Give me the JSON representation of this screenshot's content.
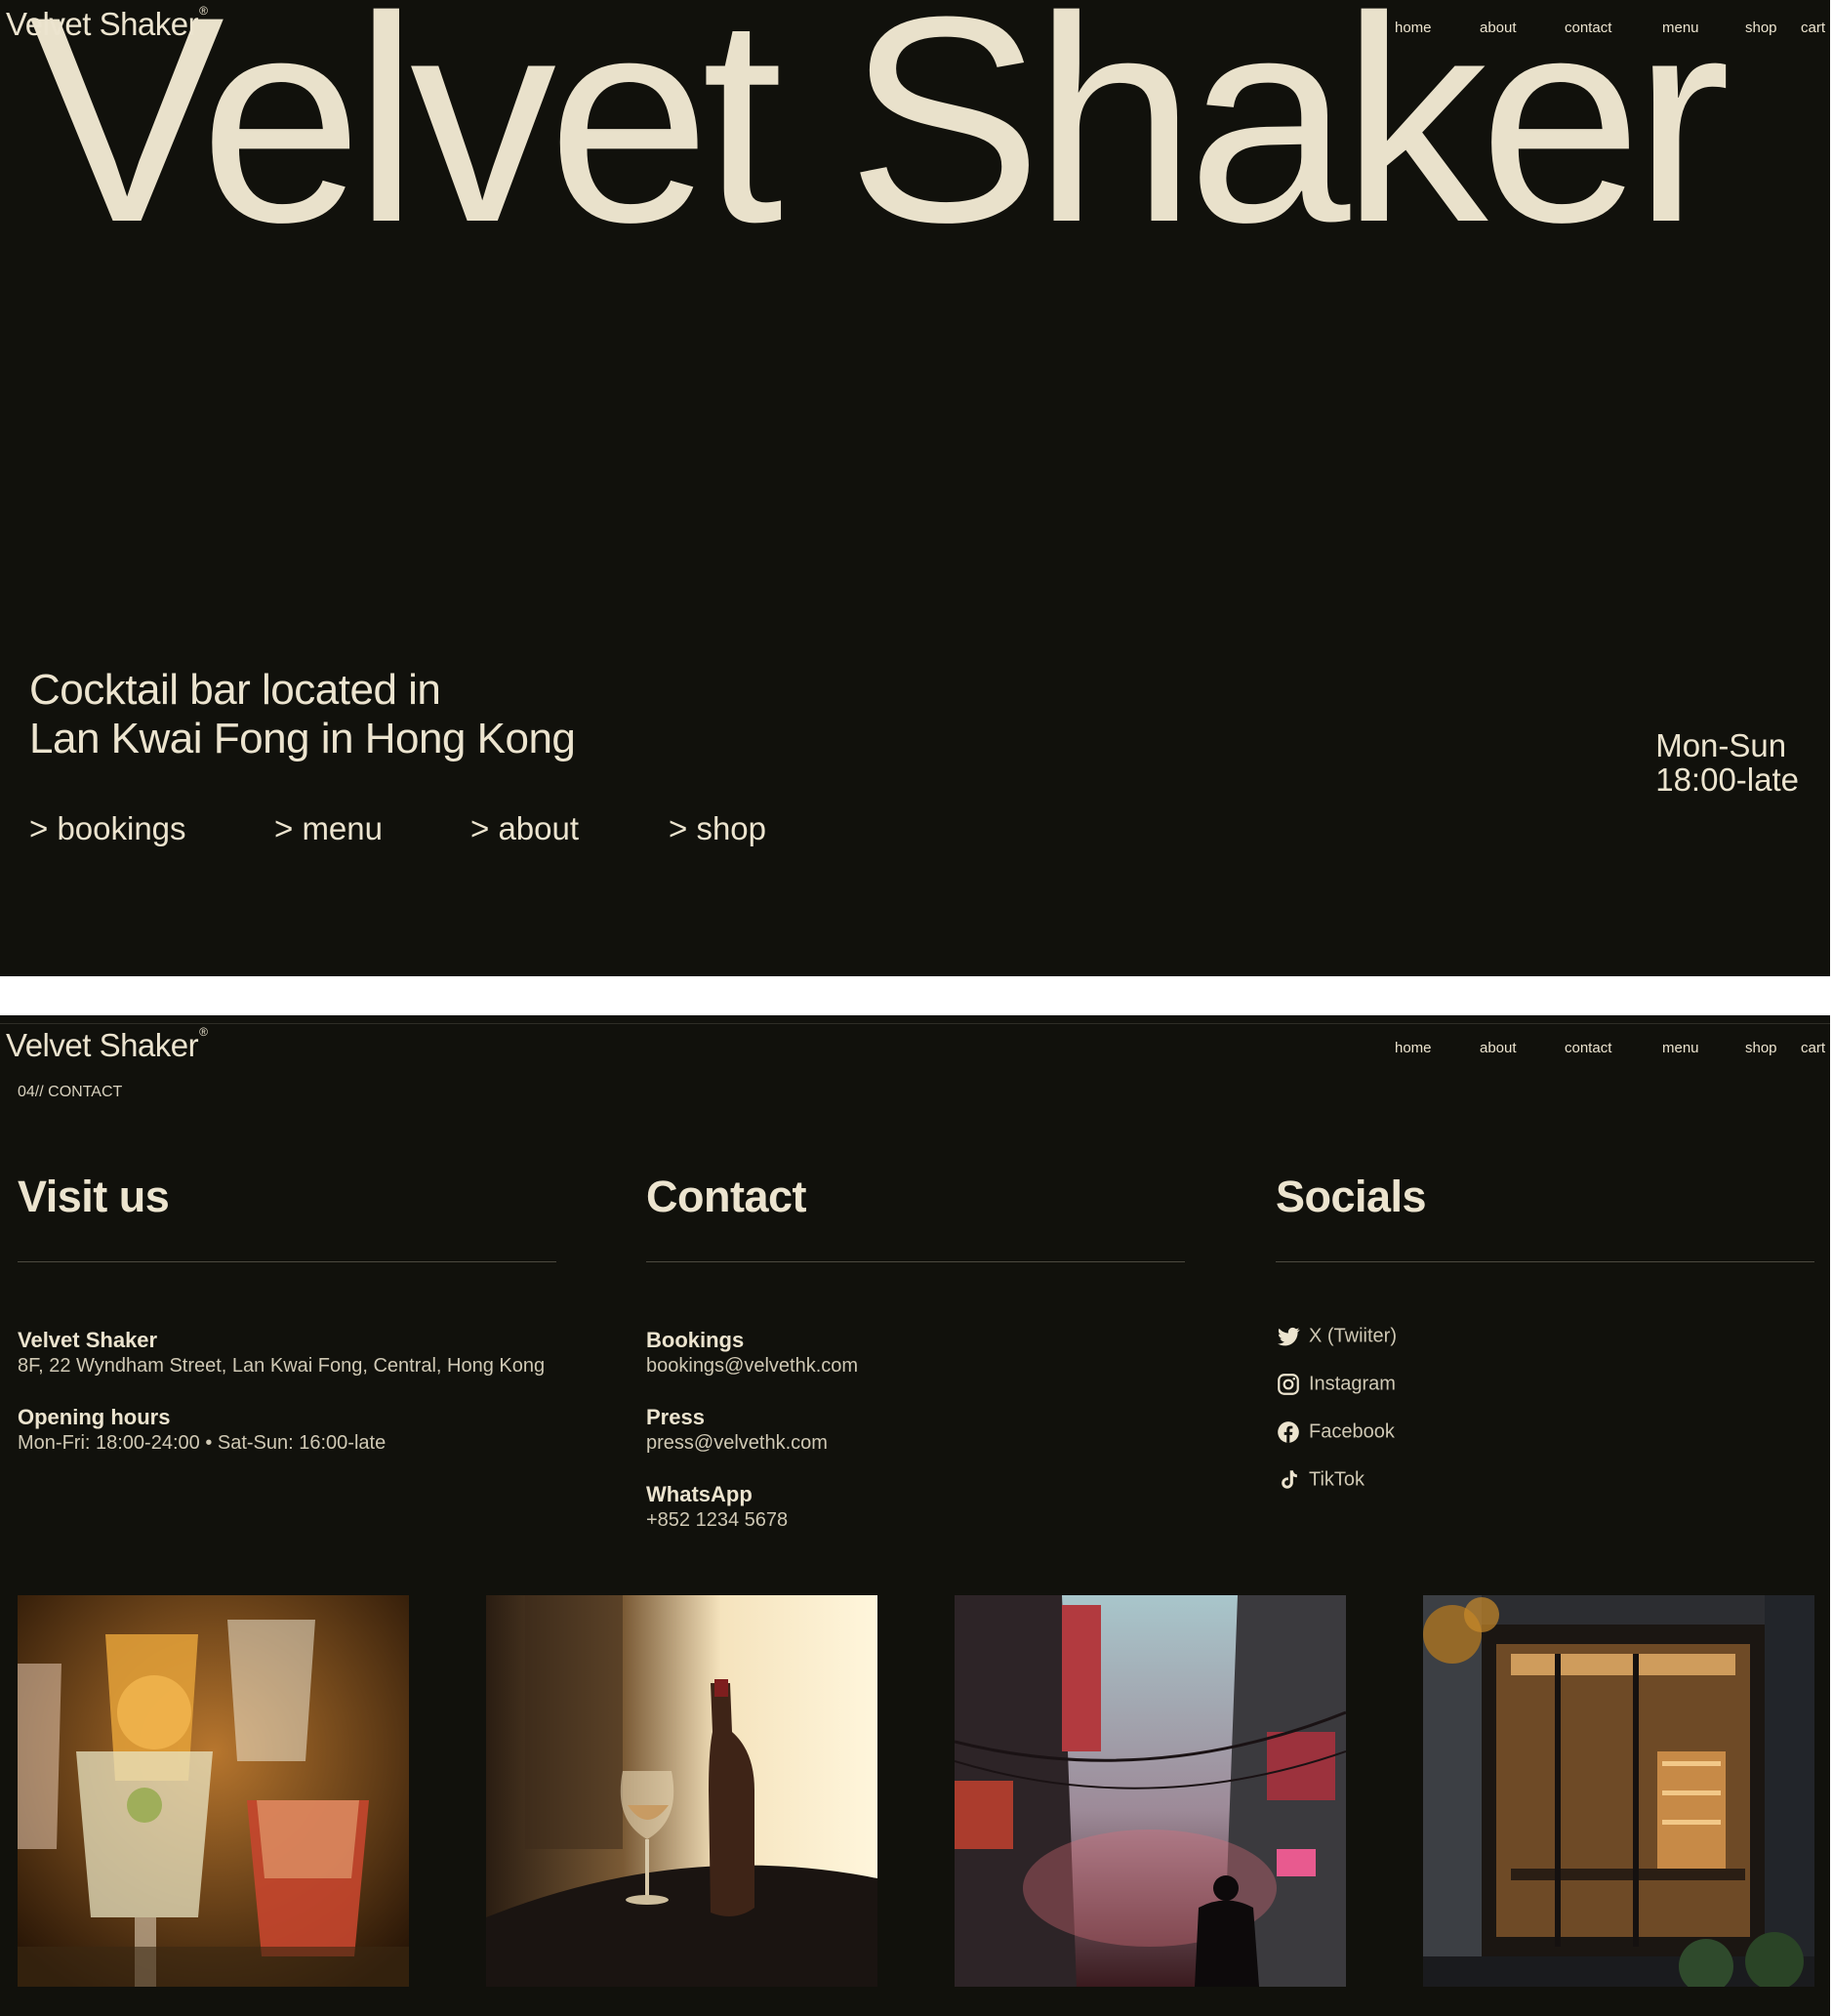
{
  "brand": {
    "name": "Velvet Shaker",
    "mark": "®"
  },
  "nav": [
    "home",
    "about",
    "contact",
    "menu",
    "shop",
    "cart"
  ],
  "hero": {
    "title": "Velvet Shaker",
    "tagline_line1": "Cocktail bar located in",
    "tagline_line2": "Lan Kwai Fong in Hong Kong",
    "hours_days": "Mon-Sun",
    "hours_time": "18:00-late",
    "links": [
      "> bookings",
      "> menu",
      "> about",
      "> shop"
    ]
  },
  "contact": {
    "section_label": "04// CONTACT",
    "visit": {
      "heading": "Visit us",
      "venue_name": "Velvet Shaker",
      "address": "8F, 22 Wyndham Street, Lan Kwai Fong, Central, Hong Kong",
      "hours_label": "Opening hours",
      "hours_value": "Mon-Fri: 18:00-24:00 • Sat-Sun: 16:00-late"
    },
    "contact": {
      "heading": "Contact",
      "bookings_label": "Bookings",
      "bookings_email": "bookings@velvethk.com",
      "press_label": "Press",
      "press_email": "press@velvethk.com",
      "whatsapp_label": "WhatsApp",
      "whatsapp_number": "+852 1234 5678"
    },
    "socials": {
      "heading": "Socials",
      "items": [
        {
          "label": "X (Twiiter)",
          "icon": "twitter-icon"
        },
        {
          "label": "Instagram",
          "icon": "instagram-icon"
        },
        {
          "label": "Facebook",
          "icon": "facebook-icon"
        },
        {
          "label": "TikTok",
          "icon": "tiktok-icon"
        }
      ]
    }
  },
  "colors": {
    "background": "#11110c",
    "text": "#ece4cf",
    "muted": "#cfc8b4"
  }
}
